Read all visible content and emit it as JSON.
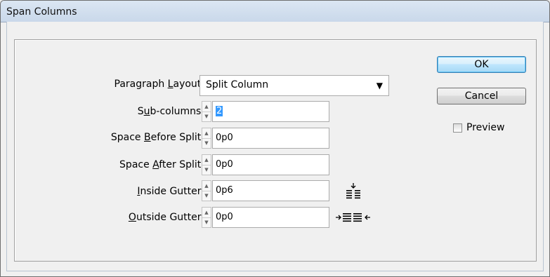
{
  "window": {
    "title": "Span Columns"
  },
  "buttons": {
    "ok": "OK",
    "cancel": "Cancel"
  },
  "preview": {
    "label": "Preview",
    "checked": false
  },
  "form": {
    "paragraph_layout": {
      "label_pre": "Paragraph ",
      "label_ul": "L",
      "label_post": "ayout:",
      "value": "Split Column"
    },
    "sub_columns": {
      "label_pre": "S",
      "label_ul": "u",
      "label_post": "b-columns:",
      "value": "2"
    },
    "space_before": {
      "label_pre": "Space ",
      "label_ul": "B",
      "label_post": "efore Split:",
      "value": "0p0"
    },
    "space_after": {
      "label_pre": "Space ",
      "label_ul": "A",
      "label_post": "fter Split:",
      "value": "0p0"
    },
    "inside_gutter": {
      "label_pre": "",
      "label_ul": "I",
      "label_post": "nside Gutter:",
      "value": "0p6"
    },
    "outside_gutter": {
      "label_pre": "",
      "label_ul": "O",
      "label_post": "utside Gutter:",
      "value": "0p0"
    }
  },
  "icons": {
    "spinner": "spinner-arrows",
    "inside_gutter": "inside-gutter-icon",
    "outside_gutter": "outside-gutter-icon",
    "dropdown": "chevron-down-icon"
  }
}
